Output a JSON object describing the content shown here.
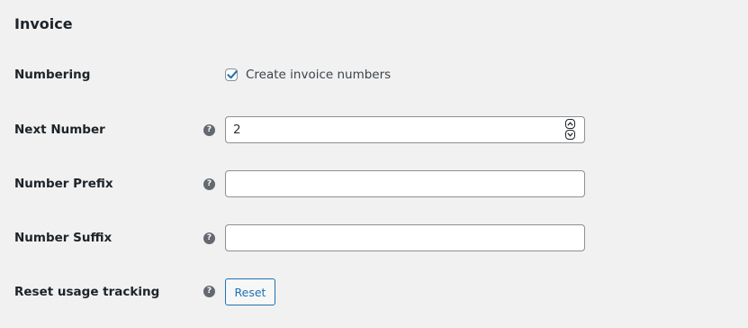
{
  "section": {
    "title": "Invoice"
  },
  "fields": {
    "numbering": {
      "label": "Numbering",
      "checkbox_label": "Create invoice numbers",
      "checked": true
    },
    "next_number": {
      "label": "Next Number",
      "value": "2",
      "help_icon": "question-mark-icon"
    },
    "number_prefix": {
      "label": "Number Prefix",
      "value": "",
      "help_icon": "question-mark-icon"
    },
    "number_suffix": {
      "label": "Number Suffix",
      "value": "",
      "help_icon": "question-mark-icon"
    },
    "reset_usage_tracking": {
      "label": "Reset usage tracking",
      "button_label": "Reset",
      "help_icon": "question-mark-icon"
    }
  },
  "colors": {
    "background": "#f1f1f1",
    "accent": "#2271b1",
    "help_icon": "#646970",
    "input_border": "#8c8f94"
  }
}
